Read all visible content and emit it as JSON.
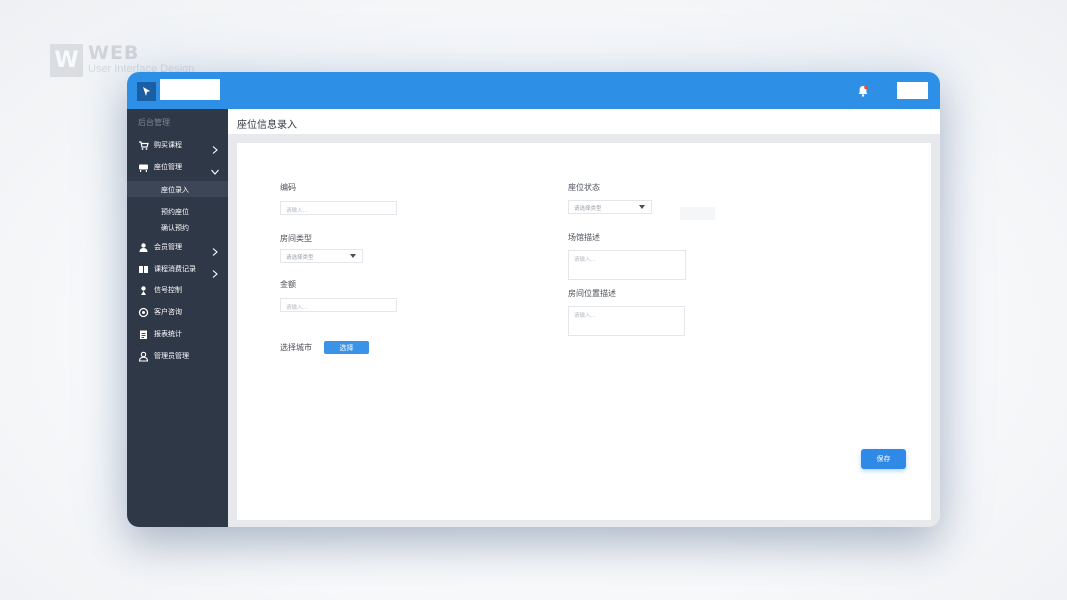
{
  "watermark": {
    "mark": "W",
    "title": "WEB",
    "subtitle": "User Interface Design"
  },
  "topbar": {
    "bell_icon": "bell-icon"
  },
  "sidebar": {
    "section_title": "后台管理",
    "items": [
      {
        "label": "购买课程",
        "icon": "cart-icon",
        "arrow": "chevron-right"
      },
      {
        "label": "座位管理",
        "icon": "seat-icon",
        "arrow": "chevron-down",
        "children": [
          {
            "label": "座位录入",
            "active": true
          },
          {
            "label": "预约座位"
          },
          {
            "label": "确认预约"
          }
        ]
      },
      {
        "label": "会员管理",
        "icon": "user-icon",
        "arrow": "chevron-right"
      },
      {
        "label": "课程消费记录",
        "icon": "book-icon",
        "arrow": "chevron-right"
      },
      {
        "label": "信号控制",
        "icon": "signal-icon"
      },
      {
        "label": "客户咨询",
        "icon": "settings-icon"
      },
      {
        "label": "报表统计",
        "icon": "clipboard-icon"
      },
      {
        "label": "管理员管理",
        "icon": "admin-icon"
      }
    ]
  },
  "page": {
    "title": "座位信息录入"
  },
  "form": {
    "code": {
      "label": "编码",
      "placeholder": "请输入..."
    },
    "room_type": {
      "label": "房间类型",
      "value": "请选择类型"
    },
    "amount": {
      "label": "金额",
      "placeholder": "请输入..."
    },
    "city": {
      "label": "选择城市",
      "button": "选择"
    },
    "seat_status": {
      "label": "座位状态",
      "value": "请选择类型"
    },
    "venue_desc": {
      "label": "场馆描述",
      "placeholder": "请输入..."
    },
    "room_location_desc": {
      "label": "房间位置描述",
      "placeholder": "请输入..."
    },
    "save_button": "保存"
  },
  "colors": {
    "primary": "#2d8fe6",
    "sidebar": "#2f3847",
    "content_bg": "#e7e9ec"
  }
}
